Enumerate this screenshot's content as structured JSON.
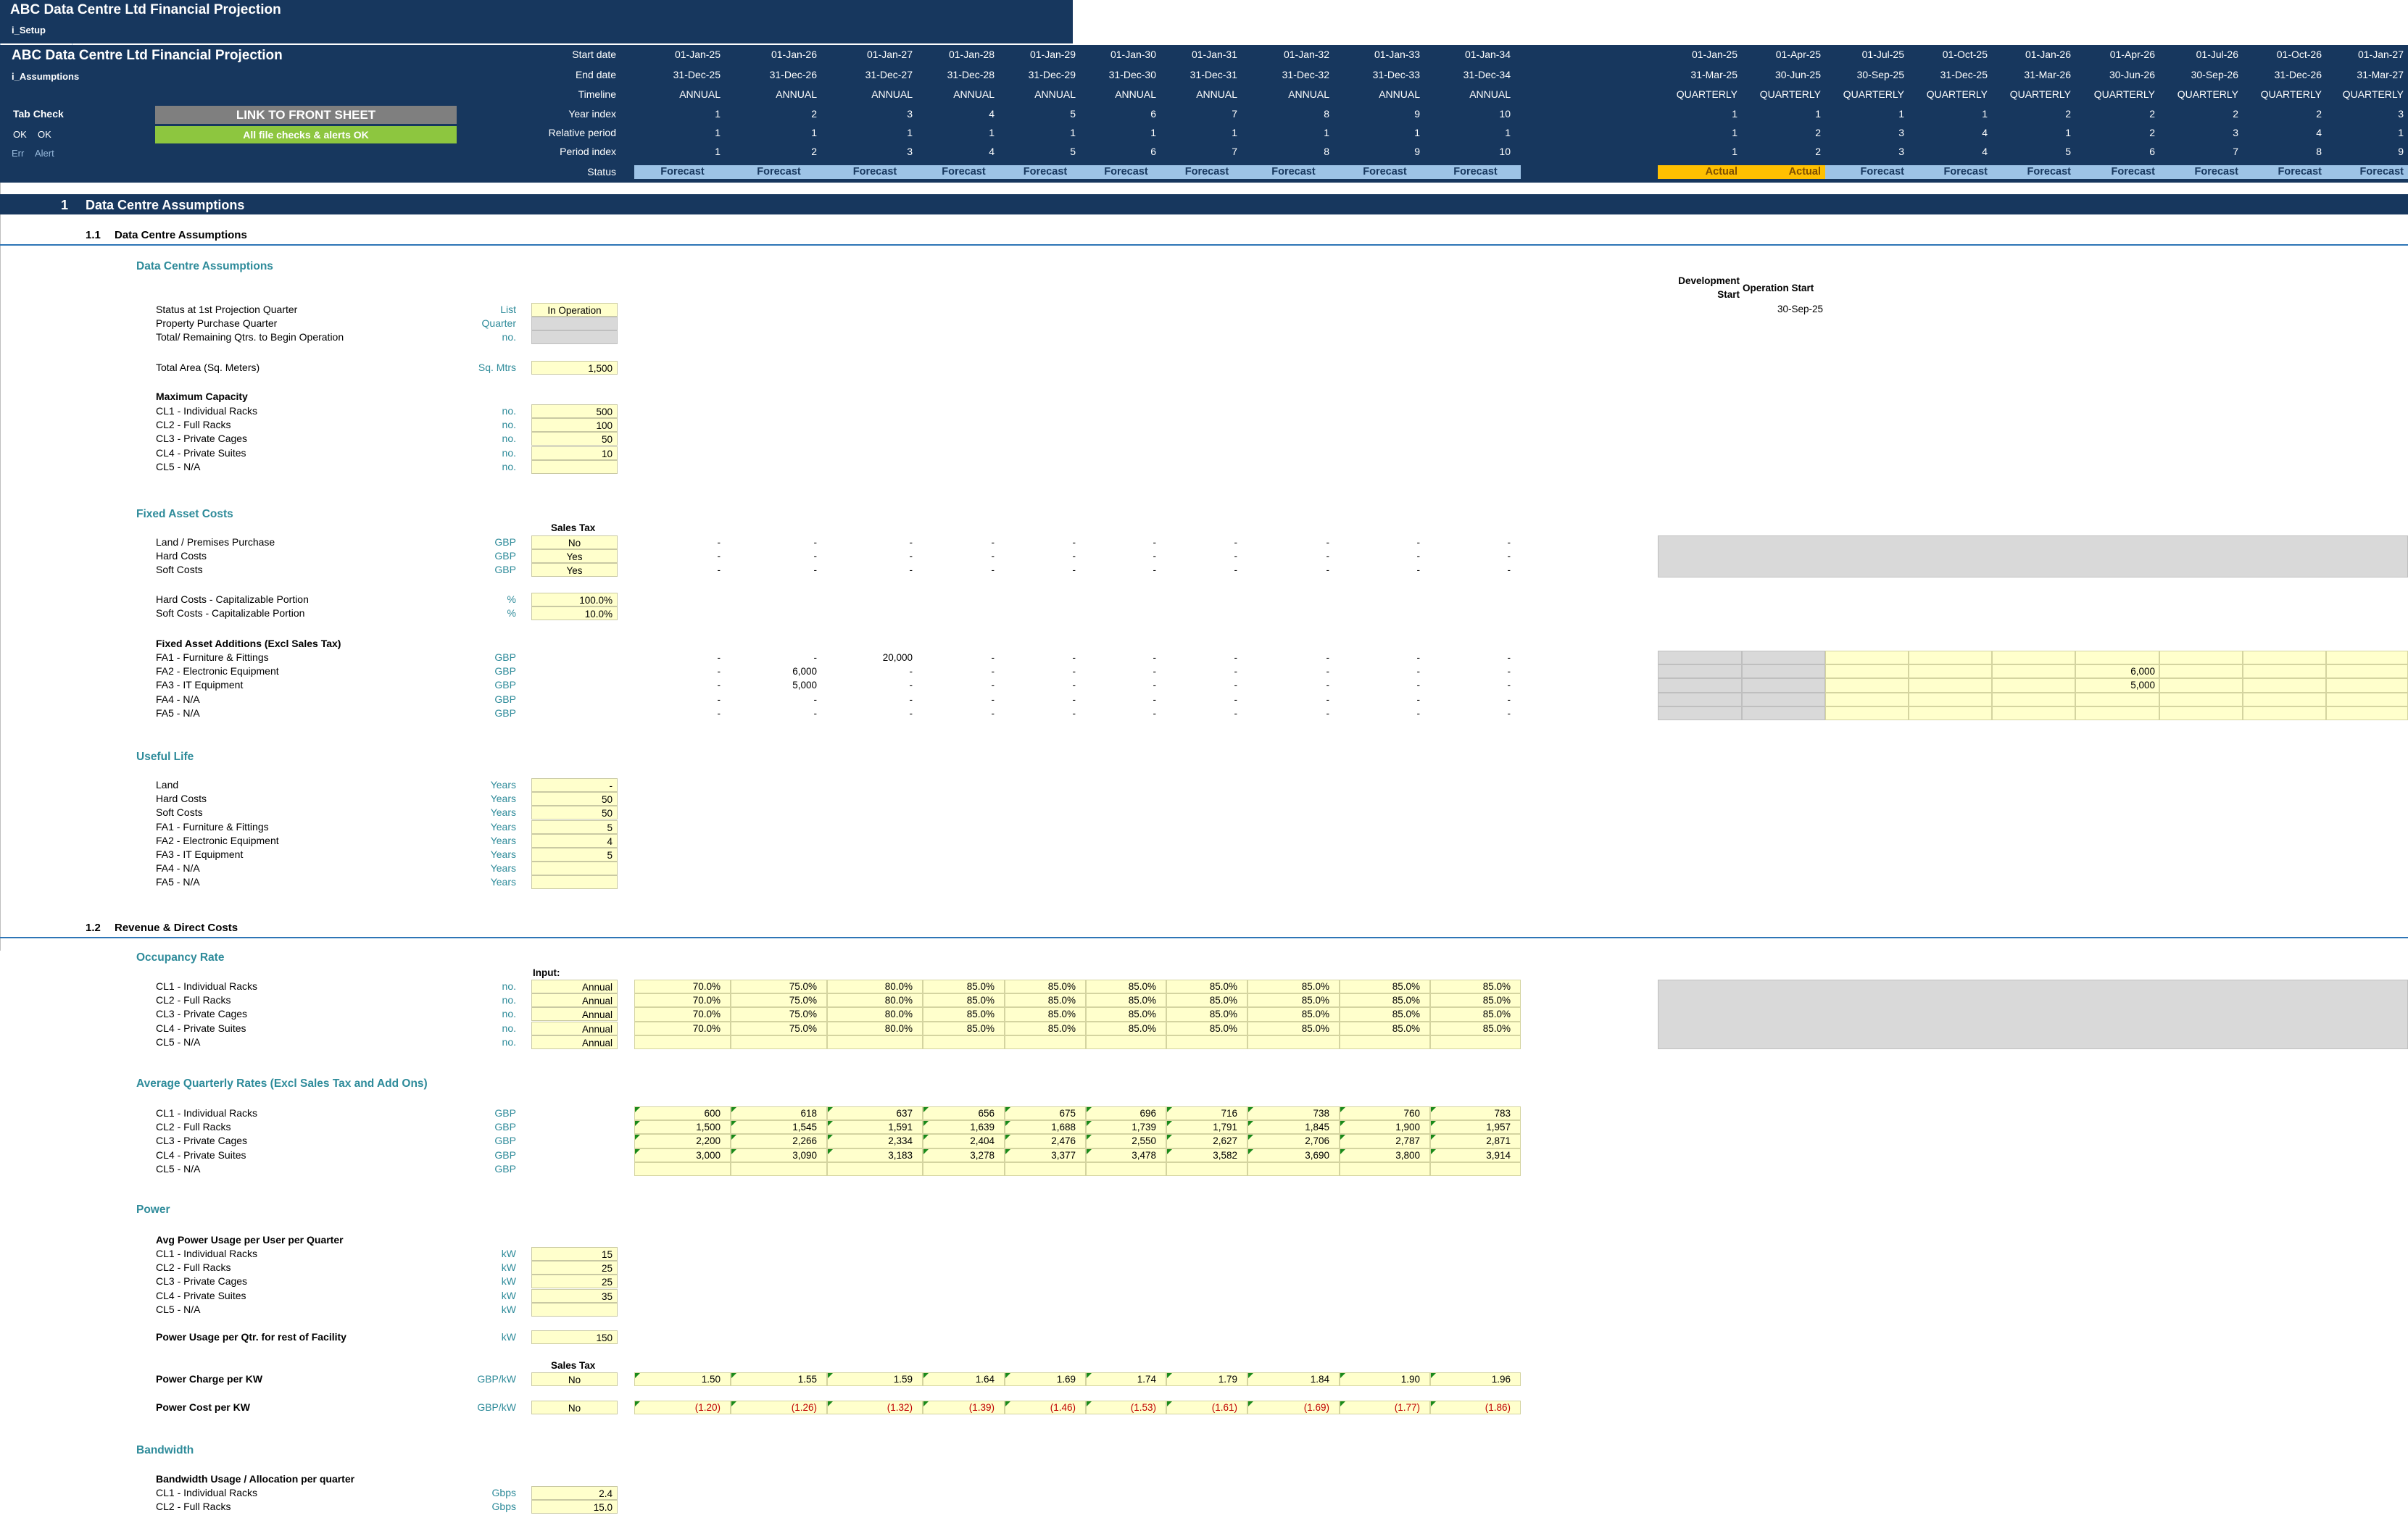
{
  "app": {
    "title": "ABC Data Centre Ltd Financial Projection",
    "setup_sheet": "i_Setup",
    "sheet": "i_Assumptions"
  },
  "header": {
    "labels": [
      "Start date",
      "End date",
      "Timeline",
      "Year index",
      "Relative period",
      "Period index",
      "Status"
    ],
    "annual": {
      "start": [
        "01-Jan-25",
        "01-Jan-26",
        "01-Jan-27",
        "01-Jan-28",
        "01-Jan-29",
        "01-Jan-30",
        "01-Jan-31",
        "01-Jan-32",
        "01-Jan-33",
        "01-Jan-34"
      ],
      "end": [
        "31-Dec-25",
        "31-Dec-26",
        "31-Dec-27",
        "31-Dec-28",
        "31-Dec-29",
        "31-Dec-30",
        "31-Dec-31",
        "31-Dec-32",
        "31-Dec-33",
        "31-Dec-34"
      ],
      "timeline": "ANNUAL",
      "year_index": [
        "1",
        "2",
        "3",
        "4",
        "5",
        "6",
        "7",
        "8",
        "9",
        "10"
      ],
      "relative": [
        "1",
        "1",
        "1",
        "1",
        "1",
        "1",
        "1",
        "1",
        "1",
        "1"
      ],
      "period_index": [
        "1",
        "2",
        "3",
        "4",
        "5",
        "6",
        "7",
        "8",
        "9",
        "10"
      ],
      "status": "Forecast"
    },
    "quarterly": {
      "start": [
        "01-Jan-25",
        "01-Apr-25",
        "01-Jul-25",
        "01-Oct-25",
        "01-Jan-26",
        "01-Apr-26",
        "01-Jul-26",
        "01-Oct-26",
        "01-Jan-27"
      ],
      "end": [
        "31-Mar-25",
        "30-Jun-25",
        "30-Sep-25",
        "31-Dec-25",
        "31-Mar-26",
        "30-Jun-26",
        "30-Sep-26",
        "31-Dec-26",
        "31-Mar-27"
      ],
      "timeline": "QUARTERLY",
      "year_index": [
        "1",
        "1",
        "1",
        "1",
        "2",
        "2",
        "2",
        "2",
        "3"
      ],
      "relative": [
        "1",
        "2",
        "3",
        "4",
        "1",
        "2",
        "3",
        "4",
        "1"
      ],
      "period_index": [
        "1",
        "2",
        "3",
        "4",
        "5",
        "6",
        "7",
        "8",
        "9"
      ],
      "status": [
        "Actual",
        "Actual",
        "Forecast",
        "Forecast",
        "Forecast",
        "Forecast",
        "Forecast",
        "Forecast",
        "Forecast"
      ]
    },
    "tab_check": {
      "title": "Tab Check",
      "ok1": "OK",
      "ok2": "OK",
      "err": "Err",
      "alert": "Alert"
    },
    "link_button": "LINK TO FRONT SHEET",
    "checks_ok": "All file checks & alerts OK"
  },
  "colors": {
    "navy": "#17375e",
    "link_grey": "#7f7f7f",
    "ok_green": "#8dc63f",
    "forecast": "#9dc3e6",
    "actual": "#ffc000",
    "input": "#ffffcc",
    "teal": "#2e8b9a"
  },
  "section1": {
    "num": "1",
    "title": "Data Centre Assumptions"
  },
  "s11": {
    "num": "1.1",
    "title": "Data Centre Assumptions"
  },
  "dca": {
    "heading": "Data Centre Assumptions",
    "dev_start": "Development Start",
    "op_start": "Operation Start",
    "op_start_date": "30-Sep-25",
    "rows": [
      {
        "label": "Status at 1st Projection Quarter",
        "unit": "List",
        "value": "In Operation"
      },
      {
        "label": "Property Purchase Quarter",
        "unit": "Quarter",
        "value": ""
      },
      {
        "label": "Total/ Remaining Qtrs. to Begin Operation",
        "unit": "no.",
        "value": ""
      }
    ],
    "area": {
      "label": "Total Area (Sq. Meters)",
      "unit": "Sq. Mtrs",
      "value": "1,500"
    },
    "maxcap_title": "Maximum Capacity",
    "maxcap": [
      {
        "label": "CL1 - Individual Racks",
        "unit": "no.",
        "value": "500"
      },
      {
        "label": "CL2 - Full Racks",
        "unit": "no.",
        "value": "100"
      },
      {
        "label": "CL3 - Private Cages",
        "unit": "no.",
        "value": "50"
      },
      {
        "label": "CL4 - Private Suites",
        "unit": "no.",
        "value": "10"
      },
      {
        "label": "CL5 - N/A",
        "unit": "no.",
        "value": ""
      }
    ]
  },
  "fixed": {
    "heading": "Fixed Asset Costs",
    "sales_tax": "Sales Tax",
    "rows": [
      {
        "label": "Land / Premises Purchase",
        "unit": "GBP",
        "value": "No"
      },
      {
        "label": "Hard Costs",
        "unit": "GBP",
        "value": "Yes"
      },
      {
        "label": "Soft Costs",
        "unit": "GBP",
        "value": "Yes"
      }
    ],
    "cap": [
      {
        "label": "Hard Costs - Capitalizable Portion",
        "unit": "%",
        "value": "100.0%"
      },
      {
        "label": "Soft Costs - Capitalizable Portion",
        "unit": "%",
        "value": "10.0%"
      }
    ],
    "add_title": "Fixed Asset Additions (Excl Sales Tax)",
    "add": [
      {
        "label": "FA1 - Furniture & Fittings",
        "unit": "GBP",
        "annual": [
          "-",
          "-",
          "20,000",
          "-",
          "-",
          "-",
          "-",
          "-",
          "-",
          "-"
        ],
        "q": [
          "",
          "",
          "",
          "",
          "",
          "",
          "",
          "",
          ""
        ]
      },
      {
        "label": "FA2 - Electronic Equipment",
        "unit": "GBP",
        "annual": [
          "-",
          "6,000",
          "-",
          "-",
          "-",
          "-",
          "-",
          "-",
          "-",
          "-"
        ],
        "q": [
          "",
          "",
          "",
          "",
          "",
          "6,000",
          "",
          "",
          ""
        ]
      },
      {
        "label": "FA3 - IT Equipment",
        "unit": "GBP",
        "annual": [
          "-",
          "5,000",
          "-",
          "-",
          "-",
          "-",
          "-",
          "-",
          "-",
          "-"
        ],
        "q": [
          "",
          "",
          "",
          "",
          "",
          "5,000",
          "",
          "",
          ""
        ]
      },
      {
        "label": "FA4 - N/A",
        "unit": "GBP",
        "annual": [
          "-",
          "-",
          "-",
          "-",
          "-",
          "-",
          "-",
          "-",
          "-",
          "-"
        ],
        "q": [
          "",
          "",
          "",
          "",
          "",
          "",
          "",
          "",
          ""
        ]
      },
      {
        "label": "FA5 - N/A",
        "unit": "GBP",
        "annual": [
          "-",
          "-",
          "-",
          "-",
          "-",
          "-",
          "-",
          "-",
          "-",
          "-"
        ],
        "q": [
          "",
          "",
          "",
          "",
          "",
          "",
          "",
          "",
          ""
        ]
      }
    ]
  },
  "useful": {
    "heading": "Useful Life",
    "rows": [
      {
        "label": "Land",
        "unit": "Years",
        "value": "-"
      },
      {
        "label": "Hard Costs",
        "unit": "Years",
        "value": "50"
      },
      {
        "label": "Soft Costs",
        "unit": "Years",
        "value": "50"
      },
      {
        "label": "FA1 - Furniture & Fittings",
        "unit": "Years",
        "value": "5"
      },
      {
        "label": "FA2 - Electronic Equipment",
        "unit": "Years",
        "value": "4"
      },
      {
        "label": "FA3 - IT Equipment",
        "unit": "Years",
        "value": "5"
      },
      {
        "label": "FA4 - N/A",
        "unit": "Years",
        "value": ""
      },
      {
        "label": "FA5 - N/A",
        "unit": "Years",
        "value": ""
      }
    ]
  },
  "s12": {
    "num": "1.2",
    "title": "Revenue & Direct Costs"
  },
  "occ": {
    "heading": "Occupancy Rate",
    "input_label": "Input:",
    "rows": [
      {
        "label": "CL1 - Individual Racks",
        "unit": "no.",
        "input": "Annual",
        "vals": [
          "70.0%",
          "75.0%",
          "80.0%",
          "85.0%",
          "85.0%",
          "85.0%",
          "85.0%",
          "85.0%",
          "85.0%",
          "85.0%"
        ]
      },
      {
        "label": "CL2 - Full Racks",
        "unit": "no.",
        "input": "Annual",
        "vals": [
          "70.0%",
          "75.0%",
          "80.0%",
          "85.0%",
          "85.0%",
          "85.0%",
          "85.0%",
          "85.0%",
          "85.0%",
          "85.0%"
        ]
      },
      {
        "label": "CL3 - Private Cages",
        "unit": "no.",
        "input": "Annual",
        "vals": [
          "70.0%",
          "75.0%",
          "80.0%",
          "85.0%",
          "85.0%",
          "85.0%",
          "85.0%",
          "85.0%",
          "85.0%",
          "85.0%"
        ]
      },
      {
        "label": "CL4 - Private Suites",
        "unit": "no.",
        "input": "Annual",
        "vals": [
          "70.0%",
          "75.0%",
          "80.0%",
          "85.0%",
          "85.0%",
          "85.0%",
          "85.0%",
          "85.0%",
          "85.0%",
          "85.0%"
        ]
      },
      {
        "label": "CL5 - N/A",
        "unit": "no.",
        "input": "Annual",
        "vals": [
          "",
          "",
          "",
          "",
          "",
          "",
          "",
          "",
          "",
          ""
        ]
      }
    ]
  },
  "rates": {
    "heading": "Average Quarterly Rates (Excl Sales Tax and Add Ons)",
    "rows": [
      {
        "label": "CL1 - Individual Racks",
        "unit": "GBP",
        "vals": [
          "600",
          "618",
          "637",
          "656",
          "675",
          "696",
          "716",
          "738",
          "760",
          "783"
        ]
      },
      {
        "label": "CL2 - Full Racks",
        "unit": "GBP",
        "vals": [
          "1,500",
          "1,545",
          "1,591",
          "1,639",
          "1,688",
          "1,739",
          "1,791",
          "1,845",
          "1,900",
          "1,957"
        ]
      },
      {
        "label": "CL3 - Private Cages",
        "unit": "GBP",
        "vals": [
          "2,200",
          "2,266",
          "2,334",
          "2,404",
          "2,476",
          "2,550",
          "2,627",
          "2,706",
          "2,787",
          "2,871"
        ]
      },
      {
        "label": "CL4 - Private Suites",
        "unit": "GBP",
        "vals": [
          "3,000",
          "3,090",
          "3,183",
          "3,278",
          "3,377",
          "3,478",
          "3,582",
          "3,690",
          "3,800",
          "3,914"
        ]
      },
      {
        "label": "CL5 - N/A",
        "unit": "GBP",
        "vals": [
          "",
          "",
          "",
          "",
          "",
          "",
          "",
          "",
          "",
          ""
        ]
      }
    ]
  },
  "power": {
    "heading": "Power",
    "avg_title": "Avg Power Usage per User per Quarter",
    "rows": [
      {
        "label": "CL1 - Individual Racks",
        "unit": "kW",
        "value": "15"
      },
      {
        "label": "CL2 - Full Racks",
        "unit": "kW",
        "value": "25"
      },
      {
        "label": "CL3 - Private Cages",
        "unit": "kW",
        "value": "25"
      },
      {
        "label": "CL4 - Private Suites",
        "unit": "kW",
        "value": "35"
      },
      {
        "label": "CL5 - N/A",
        "unit": "kW",
        "value": ""
      }
    ],
    "rest": {
      "label": "Power Usage per Qtr. for rest of Facility",
      "unit": "kW",
      "value": "150"
    },
    "sales_tax": "Sales Tax",
    "charge": {
      "label": "Power Charge per KW",
      "unit": "GBP/kW",
      "tax": "No",
      "vals": [
        "1.50",
        "1.55",
        "1.59",
        "1.64",
        "1.69",
        "1.74",
        "1.79",
        "1.84",
        "1.90",
        "1.96"
      ]
    },
    "cost": {
      "label": "Power Cost per KW",
      "unit": "GBP/kW",
      "tax": "No",
      "vals": [
        "(1.20)",
        "(1.26)",
        "(1.32)",
        "(1.39)",
        "(1.46)",
        "(1.53)",
        "(1.61)",
        "(1.69)",
        "(1.77)",
        "(1.86)"
      ]
    }
  },
  "bandwidth": {
    "heading": "Bandwidth",
    "title": "Bandwidth Usage / Allocation per quarter",
    "rows": [
      {
        "label": "CL1 - Individual Racks",
        "unit": "Gbps",
        "value": "2.4"
      },
      {
        "label": "CL2 - Full Racks",
        "unit": "Gbps",
        "value": "15.0"
      }
    ]
  }
}
